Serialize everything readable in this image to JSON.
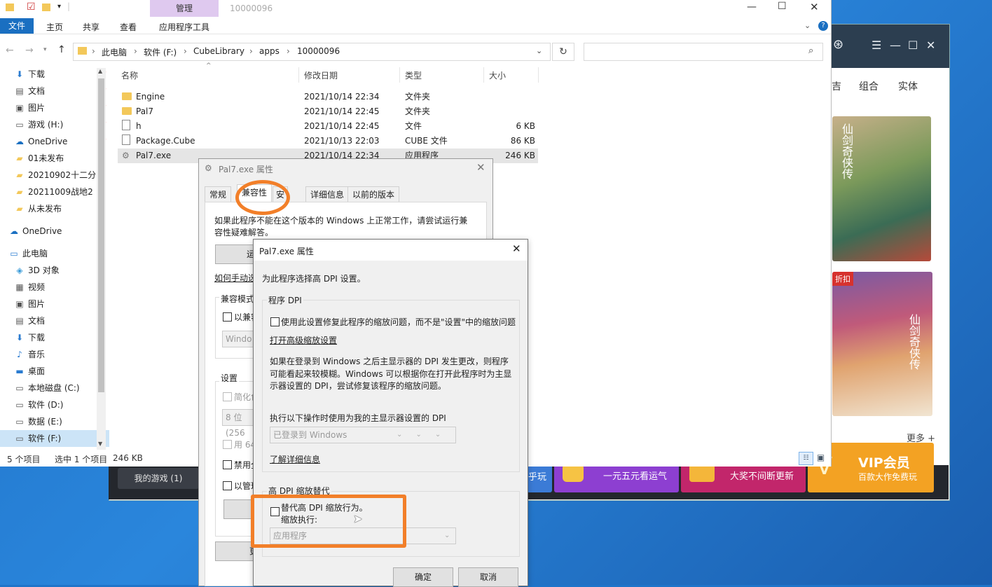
{
  "explorer": {
    "window_title": "10000096",
    "ribbon_context_label": "管理",
    "ribbon_tabs": [
      "文件",
      "主页",
      "共享",
      "查看",
      "应用程序工具"
    ],
    "breadcrumb": [
      "此电脑",
      "软件 (F:)",
      "CubeLibrary",
      "apps",
      "10000096"
    ],
    "columns": [
      "名称",
      "修改日期",
      "类型",
      "大小"
    ],
    "files": [
      {
        "name": "Engine",
        "date": "2021/10/14 22:34",
        "type": "文件夹",
        "size": "",
        "icon": "folder-icon"
      },
      {
        "name": "Pal7",
        "date": "2021/10/14 22:45",
        "type": "文件夹",
        "size": "",
        "icon": "folder-icon"
      },
      {
        "name": "h",
        "date": "2021/10/14 22:45",
        "type": "文件",
        "size": "6 KB",
        "icon": "file-icon"
      },
      {
        "name": "Package.Cube",
        "date": "2021/10/13 22:03",
        "type": "CUBE 文件",
        "size": "86 KB",
        "icon": "file-icon"
      },
      {
        "name": "Pal7.exe",
        "date": "2021/10/14 22:34",
        "type": "应用程序",
        "size": "246 KB",
        "icon": "exe-icon"
      }
    ],
    "nav_items": [
      {
        "label": "下载",
        "icon": "download-icon",
        "pinned": true
      },
      {
        "label": "文档",
        "icon": "document-icon",
        "pinned": true
      },
      {
        "label": "图片",
        "icon": "picture-icon",
        "pinned": true
      },
      {
        "label": "游戏 (H:)",
        "icon": "drive-icon",
        "pinned": true
      },
      {
        "label": "OneDrive",
        "icon": "cloud-icon",
        "pinned": true
      },
      {
        "label": "01未发布",
        "icon": "folder-icon",
        "pinned": false
      },
      {
        "label": "20210902十二分",
        "icon": "folder-icon",
        "pinned": false
      },
      {
        "label": "20211009战地2",
        "icon": "folder-icon",
        "pinned": false
      },
      {
        "label": "从未发布",
        "icon": "folder-icon",
        "pinned": false
      },
      {
        "label": "OneDrive",
        "icon": "cloud-icon",
        "pinned": false
      },
      {
        "label": "此电脑",
        "icon": "computer-icon",
        "pinned": false
      },
      {
        "label": "3D 对象",
        "icon": "cube-icon",
        "pinned": false
      },
      {
        "label": "视频",
        "icon": "video-icon",
        "pinned": false
      },
      {
        "label": "图片",
        "icon": "picture-icon",
        "pinned": false
      },
      {
        "label": "文档",
        "icon": "document-icon",
        "pinned": false
      },
      {
        "label": "下载",
        "icon": "download-icon",
        "pinned": false
      },
      {
        "label": "音乐",
        "icon": "music-icon",
        "pinned": false
      },
      {
        "label": "桌面",
        "icon": "desktop-icon",
        "pinned": false
      },
      {
        "label": "本地磁盘 (C:)",
        "icon": "drive-icon",
        "pinned": false
      },
      {
        "label": "软件 (D:)",
        "icon": "drive-icon",
        "pinned": false
      },
      {
        "label": "数据 (E:)",
        "icon": "drive-icon",
        "pinned": false
      },
      {
        "label": "软件 (F:)",
        "icon": "drive-icon",
        "pinned": false
      }
    ],
    "status": {
      "count": "5 个项目",
      "selected": "选中 1 个项目",
      "size": "246 KB"
    }
  },
  "launcher": {
    "nav_partial": "吉",
    "nav": [
      "组合",
      "实体"
    ],
    "poster1_text": "仙剑奇侠传",
    "poster2_text": "仙剑奇侠传",
    "poster2_badge": "折扣",
    "more": "更多 +",
    "my_games": "我的游戏 (1)",
    "banner_partial": "乎玩",
    "banners": [
      "一元五元看运气",
      "大奖不间断更新"
    ],
    "vip_title": "VIP会员",
    "vip_sub": "百款大作免费玩"
  },
  "props_dialog": {
    "title": "Pal7.exe 属性",
    "tabs": [
      "常规",
      "兼容性",
      "安",
      "详细信息",
      "以前的版本"
    ],
    "intro": [
      "如果此程序不能在这个版本的 Windows 上正常工作，请尝试运行兼",
      "容性疑难解答。"
    ],
    "run_button_partial": "运",
    "manual_link_partial": "如何手动选",
    "compat_group_partial": "兼容模式",
    "compat_checkbox_partial": "以兼容",
    "compat_combo_partial": "Windo",
    "settings_group": "设置",
    "reduced_color_partial": "简化色",
    "color_combo_partial": "8 位(256",
    "res640_partial": "用 640",
    "disable_fullscreen_partial": "禁用全",
    "admin_partial": "以管理",
    "change_button_partial": "",
    "bottom_button_partial": "更"
  },
  "dpi_dialog": {
    "title": "Pal7.exe 属性",
    "heading": "为此程序选择高 DPI 设置。",
    "program_dpi_group": "程序 DPI",
    "program_dpi_checkbox": "使用此设置修复此程序的缩放问题，而不是\"设置\"中的缩放问题",
    "advanced_link": "打开高级缩放设置",
    "description": [
      "如果在登录到 Windows 之后主显示器的 DPI 发生更改，则程序",
      "可能看起来较模糊。Windows 可以根据你在打开此程序时为主显",
      "示器设置的 DPI，尝试修复该程序的缩放问题。"
    ],
    "use_dpi_label": "执行以下操作时使用为我的主显示器设置的 DPI",
    "use_dpi_combo": "已登录到 Windows",
    "learn_more_link": "了解详细信息",
    "override_group": "高 DPI 缩放替代",
    "override_checkbox": "替代高 DPI 缩放行为。",
    "scaling_by": "缩放执行:",
    "scaling_combo": "应用程序",
    "ok": "确定",
    "cancel": "取消"
  },
  "colors": {
    "accent": "#1a6fc1",
    "highlight": "#f27f29",
    "ribbon_context": "#dfc9ef"
  }
}
